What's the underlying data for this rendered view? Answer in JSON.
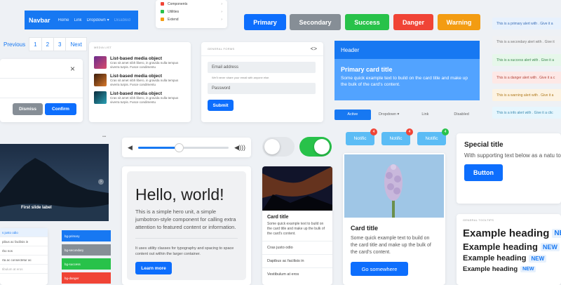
{
  "navbar": {
    "brand": "Navbar",
    "items": [
      "Home",
      "Link",
      "Dropdown ▾",
      "Disabled"
    ]
  },
  "top_list": {
    "items": [
      {
        "label": "Components",
        "color": "#f04436"
      },
      {
        "label": "Utilities",
        "color": "#28c24a"
      },
      {
        "label": "Extend",
        "color": "#f39c12"
      }
    ]
  },
  "buttons": {
    "primary": "Primary",
    "secondary": "Secondary",
    "success": "Success",
    "danger": "Danger",
    "warning": "Warning"
  },
  "pagination": {
    "previous": "Previous",
    "pages": [
      "1",
      "2",
      "3"
    ],
    "next": "Next"
  },
  "modal": {
    "dismiss": "Dismiss",
    "confirm": "Confirm",
    "close": "×"
  },
  "media": {
    "section_label": "Media list",
    "items": [
      {
        "title": "List-based media object",
        "text": "Cras sit amet nibh libero, in gravida nulla tempus viverra turpis. Fusce condimentu",
        "color": "#8e3b7d"
      },
      {
        "title": "List-based media object",
        "text": "Cras sit amet nibh libero, in gravida nulla tempus viverra turpis. Fusce condimentu",
        "color": "#b4561f"
      },
      {
        "title": "List-based media object",
        "text": "Cras sit amet nibh libero, in gravida nulla tempus viverra turpis. Fusce condimentu",
        "color": "#1d6b7d"
      }
    ]
  },
  "forms": {
    "section_label": "General forms",
    "email_placeholder": "Email address",
    "email_help": "We'll never share your email with anyone else.",
    "password_placeholder": "Password",
    "submit": "Submit"
  },
  "primary_card": {
    "header": "Header",
    "title": "Primary card title",
    "text": "Some quick example text to build on the card title and make up the bulk of the card's content."
  },
  "nav_pills": {
    "items": [
      "Active",
      "Dropdown ▾",
      "Link",
      "Disabled"
    ]
  },
  "alerts": [
    {
      "text": "This is a primary alert with . Give it a",
      "bg": "#e7f1fd",
      "fg": "#3b6fb8"
    },
    {
      "text": "This is a secondary alert with . Give it",
      "bg": "#f0f1f3",
      "fg": "#777"
    },
    {
      "text": "This is a success alert with . Give it a",
      "bg": "#e6f7ea",
      "fg": "#3b8a4d"
    },
    {
      "text": "This is a danger alert with . Give it a c",
      "bg": "#fde8e6",
      "fg": "#b4453a"
    },
    {
      "text": "This is a warning alert with . Give it a",
      "bg": "#fdf3e2",
      "fg": "#b07a1d"
    },
    {
      "text": "This is a info alert with . Give it a clic",
      "bg": "#e6f6fd",
      "fg": "#3b8ab0"
    }
  ],
  "carousel": {
    "caption": "First slide label"
  },
  "player": {
    "progress_percent": 45
  },
  "toggles": {
    "left_on": false,
    "right_on": true
  },
  "jumbotron": {
    "heading": "Hello, world!",
    "lead": "This is a simple hero unit, a simple jumbotron-style component for calling extra attention to featured content or information.",
    "text": "It uses utility classes for typography and spacing to space content out within the larger container.",
    "button": "Learn more"
  },
  "image_card": {
    "title": "Card title",
    "text": "Some quick example text to build on the card title and make up the bulk of the card's content.",
    "items": [
      "Cras justo odio",
      "Dapibus ac facilisis in",
      "Vestibulum at eros"
    ]
  },
  "notifications": [
    {
      "label": "Notific",
      "badge": "4",
      "color": "#f04436"
    },
    {
      "label": "Notific",
      "badge": "4",
      "color": "#f04436"
    },
    {
      "label": "Notific",
      "badge": "4",
      "color": "#28c24a"
    }
  ],
  "flower_card": {
    "title": "Card title",
    "text": "Some quick example text to build on the card title and make up the bulk of the card's content.",
    "button": "Go somewhere"
  },
  "special_card": {
    "title": "Special title",
    "text": "With supporting text below as a natu to additional content.",
    "button": "Button"
  },
  "tooltips": {
    "section_label": "General tooltips",
    "headings": [
      "Example heading",
      "Example heading",
      "Example heading",
      "Example heading"
    ],
    "badge": "NEW"
  },
  "left_list": {
    "items": [
      "s justo odio",
      "pibus ac facilisis in",
      "rbo nos",
      "rta ac consectetur ac",
      "tibulum at eros"
    ]
  },
  "color_list": {
    "items": [
      {
        "label": "bg-primary",
        "color": "#1778f2"
      },
      {
        "label": "bg-secondary",
        "color": "#868e96"
      },
      {
        "label": "bg-success",
        "color": "#28c24a"
      },
      {
        "label": "bg-danger",
        "color": "#f04436"
      }
    ]
  }
}
